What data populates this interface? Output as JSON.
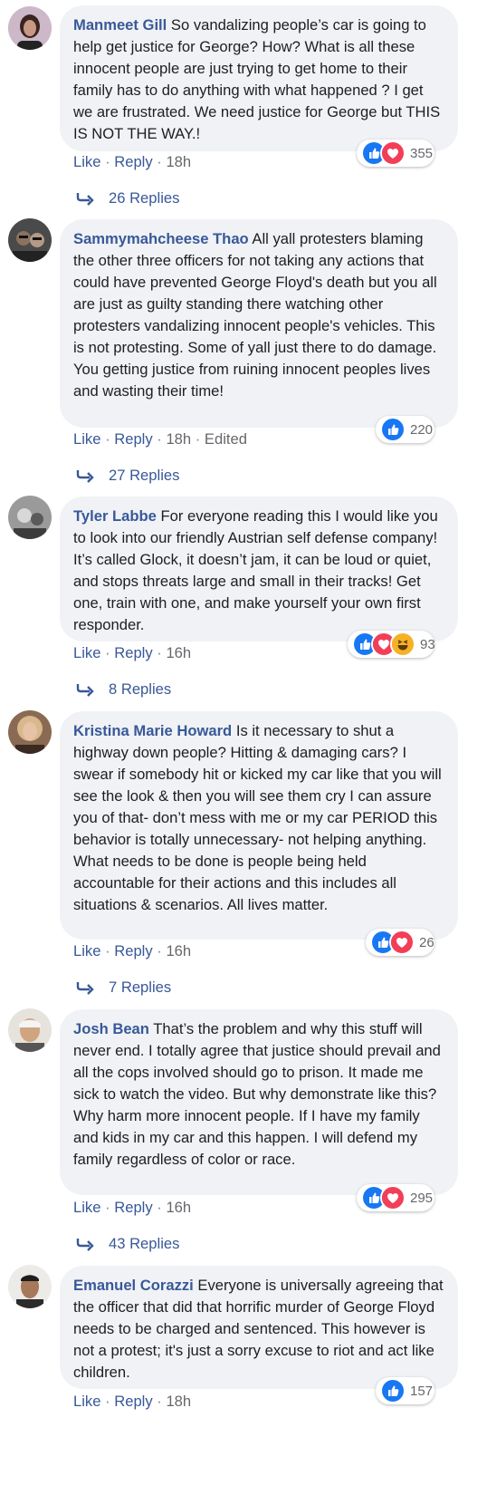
{
  "action_labels": {
    "like": "Like",
    "reply": "Reply",
    "separator": "·"
  },
  "colors": {
    "author": "#385898",
    "bubble": "#f0f2f5",
    "like_blue": "#1877f2",
    "love_red": "#f33e58",
    "haha_yellow": "#f7b125"
  },
  "comments": [
    {
      "author": "Manmeet Gill",
      "text": "So vandalizing people’s car is going to help get justice for George? How? What is all these innocent people are just trying to get home to their family has to do anything with what happened ? I get we are frustrated. We need justice for George but THIS IS NOT THE WAY.!",
      "time": "18h",
      "edited": "",
      "reactions": [
        "like-icon",
        "love-icon"
      ],
      "reaction_count": "355",
      "replies": "26 Replies"
    },
    {
      "author": "Sammymahcheese Thao",
      "text": "All yall protesters blaming the other three officers for not taking any actions that could have prevented George Floyd's death but you all are just as guilty standing there watching other protesters vandalizing innocent people's vehicles. This is not protesting. Some of yall just there to do damage. You getting justice from ruining innocent peoples lives and wasting their time!",
      "time": "18h",
      "edited": "Edited",
      "reactions": [
        "like-icon"
      ],
      "reaction_count": "220",
      "replies": "27 Replies"
    },
    {
      "author": "Tyler Labbe",
      "text": "For everyone reading this I would like you to look into our friendly Austrian self defense company! It’s called Glock, it doesn’t jam, it can be loud or quiet, and stops threats large and small in their tracks! Get one, train with one, and make yourself your own first responder.",
      "time": "16h",
      "edited": "",
      "reactions": [
        "like-icon",
        "love-icon",
        "haha-icon"
      ],
      "reaction_count": "93",
      "replies": "8 Replies"
    },
    {
      "author": "Kristina Marie Howard",
      "text": "Is it necessary to shut a highway down people? Hitting & damaging cars? I swear if somebody hit or kicked my car like that you will see the look & then you will see them cry I can assure you of that- don’t mess with me or my car PERIOD this behavior is totally unnecessary- not helping anything. What needs to be done is people being held accountable for their actions and this includes all situations & scenarios. All lives matter.",
      "time": "16h",
      "edited": "",
      "reactions": [
        "like-icon",
        "love-icon"
      ],
      "reaction_count": "26",
      "replies": "7 Replies"
    },
    {
      "author": "Josh Bean",
      "text": "That’s the problem and why this stuff will never end. I totally agree that justice should prevail and all the cops involved should go to prison. It made me sick to watch the video. But why demonstrate like this? Why harm more innocent people. If I have my family and kids in my car and this happen. I will defend my family regardless of color or race.",
      "time": "16h",
      "edited": "",
      "reactions": [
        "like-icon",
        "love-icon"
      ],
      "reaction_count": "295",
      "replies": "43 Replies"
    },
    {
      "author": "Emanuel Corazzi",
      "text": "Everyone is universally agreeing that the officer that did that horrific murder of George Floyd needs to be charged and sentenced. This however is not a protest; it's just a sorry excuse to riot and act like children.",
      "time": "18h",
      "edited": "",
      "reactions": [
        "like-icon"
      ],
      "reaction_count": "157",
      "replies": ""
    }
  ]
}
